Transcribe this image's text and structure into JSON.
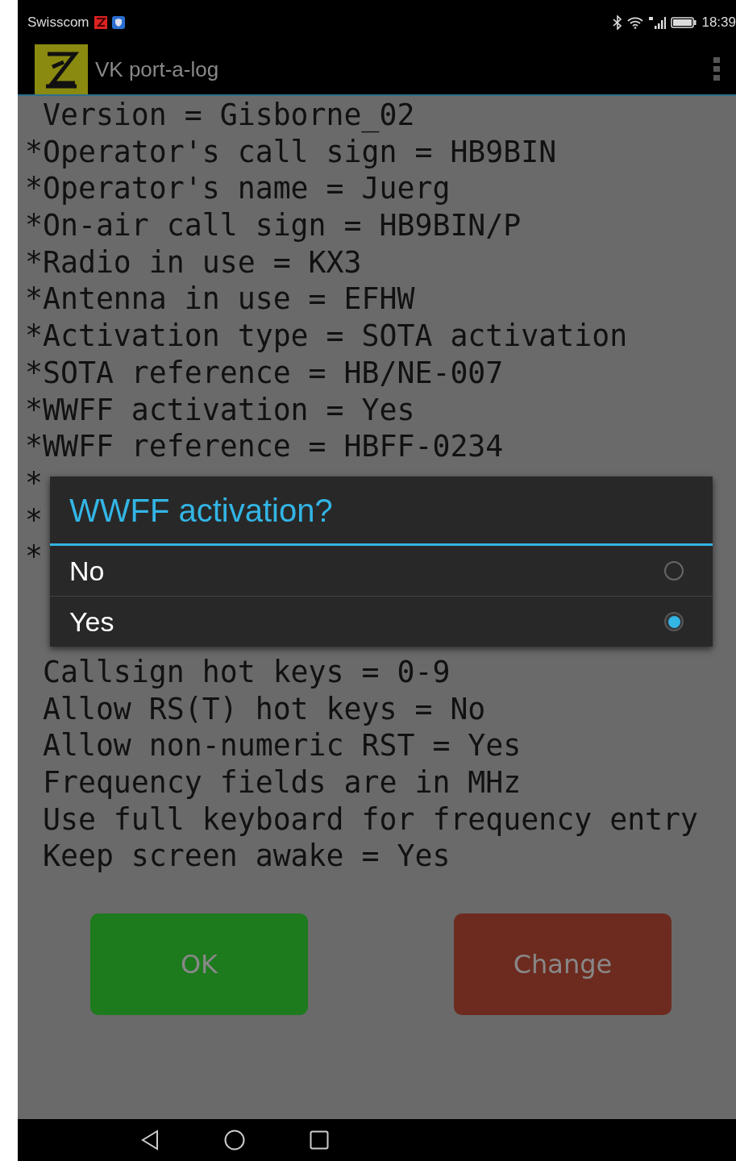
{
  "status_bar": {
    "carrier": "Swisscom",
    "time": "18:39"
  },
  "app_bar": {
    "title": "VK port-a-log"
  },
  "settings_lines": [
    " Version = Gisborne_02",
    "*Operator's call sign = HB9BIN",
    "*Operator's name = Juerg",
    "*On-air call sign = HB9BIN/P",
    "*Radio in use = KX3",
    "*Antenna in use = EFHW",
    "*Activation type = SOTA activation",
    "*SOTA reference = HB/NE-007",
    "*WWFF activation = Yes",
    "*WWFF reference = HBFF-0234",
    "*",
    "*",
    "*"
  ],
  "settings_lines_below_dialog": [
    " Callsign hot keys = 0-9",
    " Allow RS(T) hot keys = No",
    " Allow non-numeric RST = Yes",
    " Frequency fields are in MHz",
    " Use full keyboard for frequency entry",
    " Keep screen awake = Yes"
  ],
  "dialog": {
    "title": "WWFF activation?",
    "options": [
      {
        "label": "No",
        "selected": false
      },
      {
        "label": "Yes",
        "selected": true
      }
    ]
  },
  "buttons": [
    {
      "label": "OK",
      "kind": "confirm"
    },
    {
      "label": "Change",
      "kind": "change"
    }
  ]
}
